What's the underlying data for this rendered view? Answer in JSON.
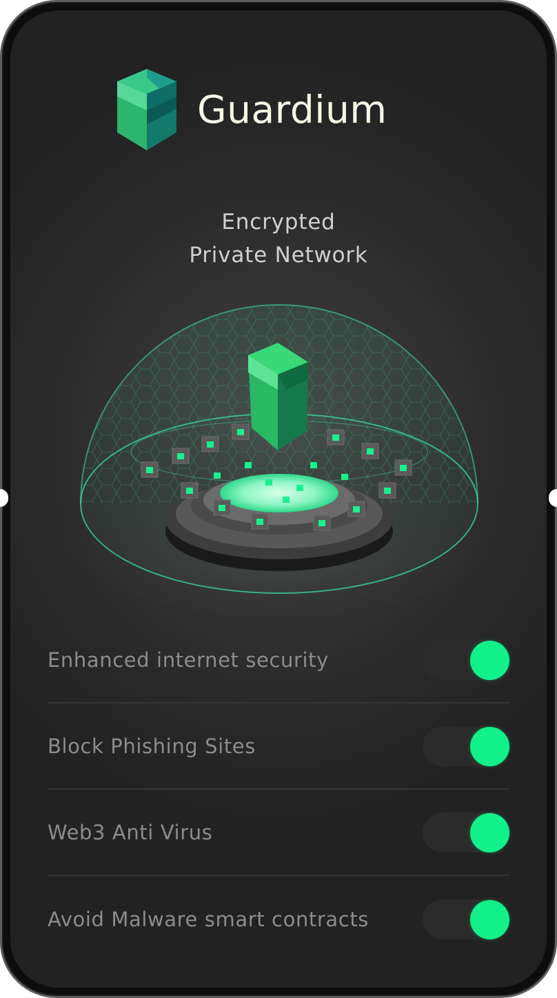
{
  "brand": {
    "name": "Guardium",
    "logo_icon": "green-cube-shield-icon"
  },
  "headline": {
    "line1": "Encrypted",
    "line2": "Private Network"
  },
  "hero": {
    "icon": "network-dome-shield-illustration"
  },
  "settings": [
    {
      "label": "Enhanced internet security",
      "enabled": true
    },
    {
      "label": "Block Phishing Sites",
      "enabled": true
    },
    {
      "label": "Web3 Anti Virus",
      "enabled": true
    },
    {
      "label": "Avoid Malware smart contracts",
      "enabled": true
    }
  ],
  "colors": {
    "accent": "#12f08a",
    "background": "#2a2a2a",
    "brand_text": "#f4f9e6"
  }
}
